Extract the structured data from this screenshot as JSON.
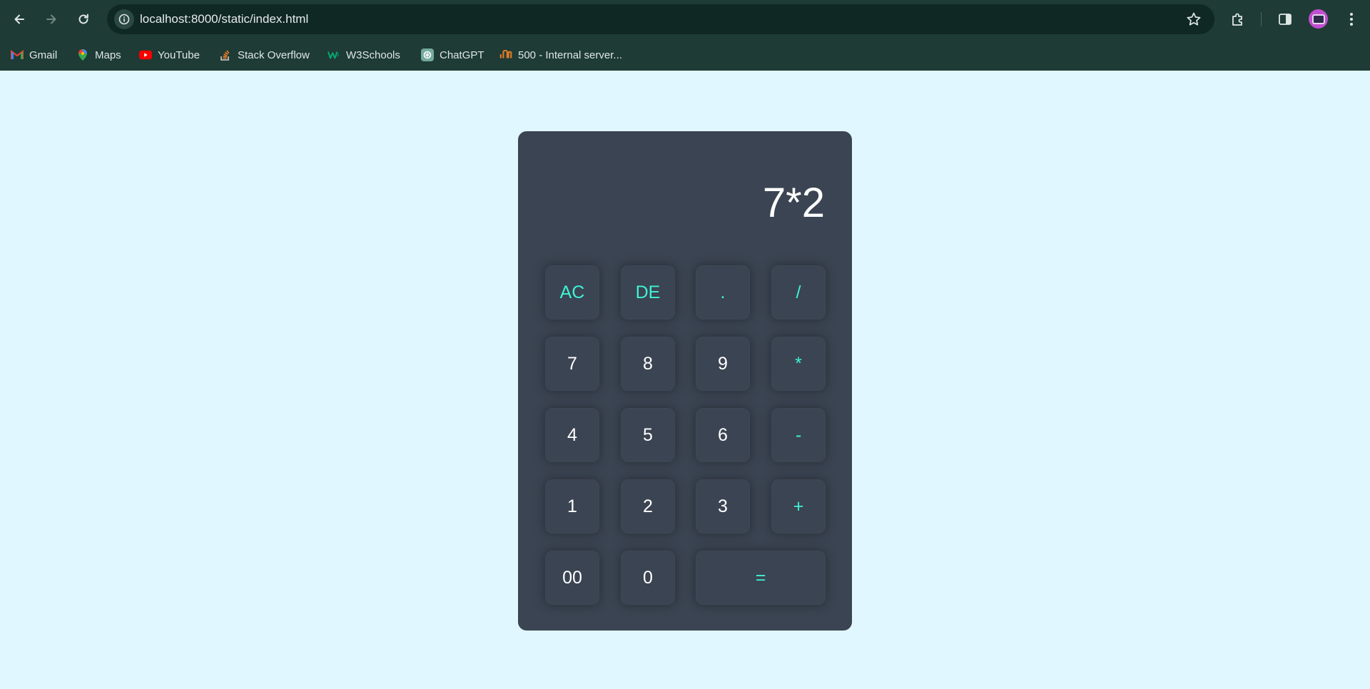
{
  "browser": {
    "url": "localhost:8000/static/index.html",
    "icons": {
      "back": "arrow-left-icon",
      "forward": "arrow-right-icon",
      "reload": "reload-icon",
      "site_info": "info-icon",
      "bookmark_star": "star-icon",
      "extensions": "puzzle-icon",
      "side_panel": "side-panel-icon",
      "menu": "kebab-menu-icon"
    },
    "bookmarks": [
      {
        "label": "Gmail",
        "icon": "gmail-icon"
      },
      {
        "label": "Maps",
        "icon": "maps-icon"
      },
      {
        "label": "YouTube",
        "icon": "youtube-icon"
      },
      {
        "label": "Stack Overflow",
        "icon": "stackoverflow-icon"
      },
      {
        "label": "W3Schools",
        "icon": "w3schools-icon"
      },
      {
        "label": "ChatGPT",
        "icon": "chatgpt-icon"
      },
      {
        "label": "500 - Internal server...",
        "icon": "site-icon"
      }
    ]
  },
  "calculator": {
    "display": "7*2",
    "keys": {
      "ac": "AC",
      "de": "DE",
      "dot": ".",
      "divide": "/",
      "seven": "7",
      "eight": "8",
      "nine": "9",
      "multiply": "*",
      "four": "4",
      "five": "5",
      "six": "6",
      "minus": "-",
      "one": "1",
      "two": "2",
      "three": "3",
      "plus": "+",
      "double_zero": "00",
      "zero": "0",
      "equals": "="
    },
    "colors": {
      "page_background": "#e0f7ff",
      "body": "#3b4452",
      "operator_text": "#3ef2d6",
      "digit_text": "#ffffff"
    }
  }
}
